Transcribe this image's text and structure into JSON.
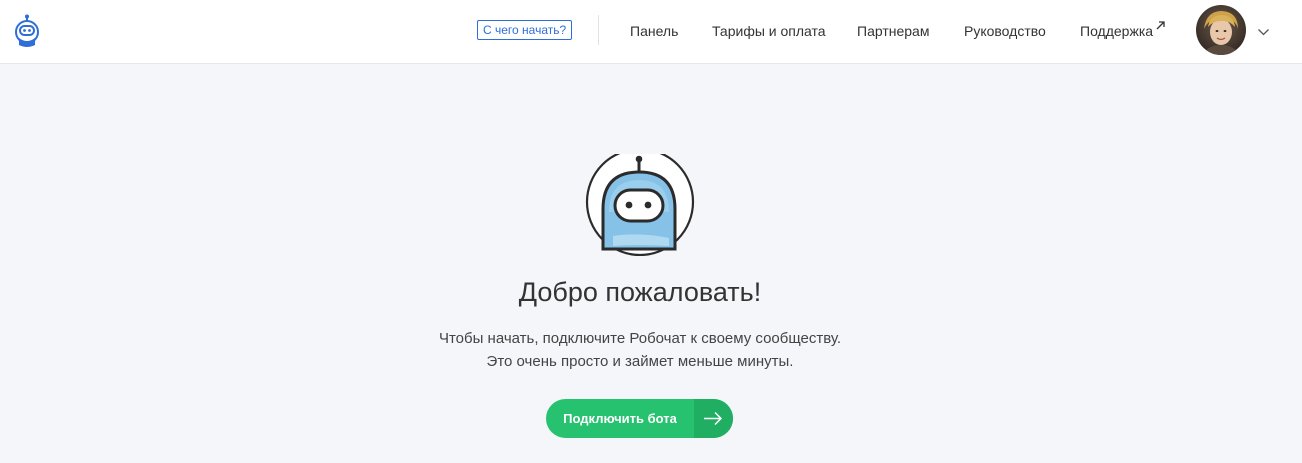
{
  "header": {
    "start_link": "С чего начать?",
    "nav": {
      "panel": "Панель",
      "tariffs": "Тарифы и оплата",
      "partners": "Партнерам",
      "guide": "Руководство",
      "support": "Поддержка"
    },
    "icons": {
      "logo": "robot-logo-icon",
      "external": "external-link-icon",
      "avatar": "user-avatar",
      "menu": "chevron-down-icon"
    }
  },
  "main": {
    "title": "Добро пожаловать!",
    "description_line1": "Чтобы начать, подключите Робочат к своему сообществу.",
    "description_line2": "Это очень просто и займет меньше минуты.",
    "connect_button": "Подключить бота"
  },
  "colors": {
    "accent_blue": "#2f6ed8",
    "button_green": "#26c26f",
    "button_green_dark": "#1fae62",
    "background": "#f5f6fa"
  }
}
